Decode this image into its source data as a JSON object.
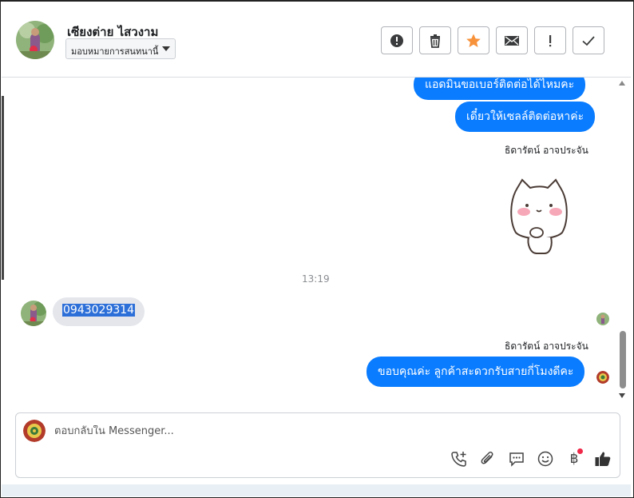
{
  "header": {
    "contact_name": "เซียงต่าย ไสวงาม",
    "assign_label": "มอบหมายการสนทนานี้"
  },
  "actions": [
    {
      "icon": "alert-icon"
    },
    {
      "icon": "trash-icon"
    },
    {
      "icon": "star-icon",
      "color": "#f7923b"
    },
    {
      "icon": "mail-icon"
    },
    {
      "icon": "exclamation-icon"
    },
    {
      "icon": "check-icon"
    }
  ],
  "messages": {
    "out_1": "แอดมินขอเบอร์ติดต่อได้ไหมคะ",
    "out_2": "เดี๋ยวให้เซลล์ติดต่อหาค่ะ",
    "sender_1": "ธิดารัตน์ อาจประจัน",
    "timestamp": "13:19",
    "in_1": "0943029314",
    "sender_2": "ธิดารัตน์ อาจประจัน",
    "out_3": "ขอบคุณค่ะ ลูกค้าสะดวกรับสายกี่โมงดีคะ"
  },
  "composer": {
    "placeholder": "ตอบกลับใน Messenger...",
    "baht_symbol": "฿"
  },
  "colors": {
    "outgoing_bubble": "#0a7cff",
    "incoming_bubble": "#e4e6eb",
    "notification_dot": "#f02849"
  }
}
